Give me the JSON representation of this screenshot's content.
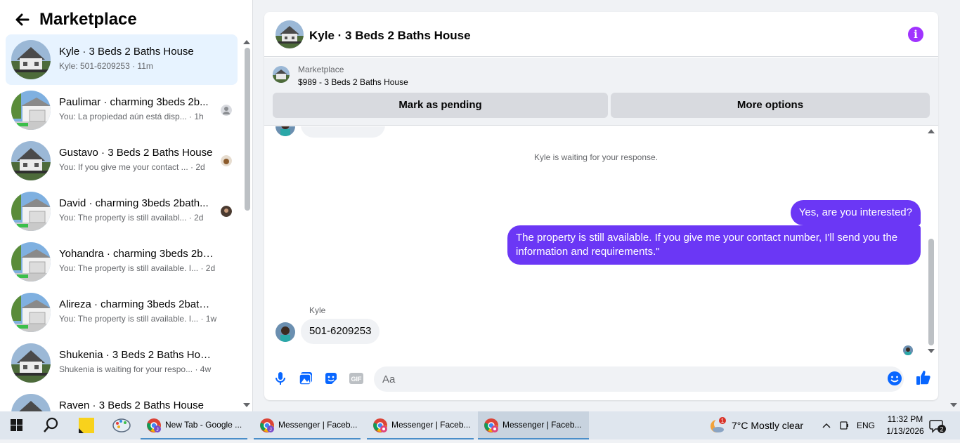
{
  "sidebar": {
    "title": "Marketplace",
    "conversations": [
      {
        "name": "Kyle · 3 Beds 2 Baths House",
        "preview": "Kyle: 501-6209253",
        "time": "11m",
        "avatar": "house"
      },
      {
        "name": "Paulimar · charming 3beds 2b...",
        "preview": "You: La propiedad aún está disp...",
        "time": "1h",
        "avatar": "garage"
      },
      {
        "name": "Gustavo · 3 Beds 2 Baths House",
        "preview": "You: If you give me your contact ...",
        "time": "2d",
        "avatar": "house"
      },
      {
        "name": "David · charming 3beds 2bath...",
        "preview": "You: The property is still availabl...",
        "time": "2d",
        "avatar": "garage"
      },
      {
        "name": "Yohandra · charming 3beds 2bat...",
        "preview": "You: The property is still available. I...",
        "time": "2d",
        "avatar": "garage"
      },
      {
        "name": "Alireza · charming 3beds 2bathr...",
        "preview": "You: The property is still available. I...",
        "time": "1w",
        "avatar": "garage"
      },
      {
        "name": "Shukenia · 3 Beds 2 Baths House",
        "preview": "Shukenia is waiting for your respo...",
        "time": "4w",
        "avatar": "house"
      },
      {
        "name": "Raven · 3 Beds 2 Baths House",
        "preview": "",
        "time": "",
        "avatar": "house"
      }
    ]
  },
  "chat": {
    "title": "Kyle · 3 Beds 2 Baths House",
    "marketplace_label": "Marketplace",
    "listing": "$989 - 3 Beds 2 Baths House",
    "mark_pending": "Mark as pending",
    "more_options": "More options",
    "waiting_notice": "Kyle is waiting for your response.",
    "messages": {
      "out1": "Yes, are you interested?",
      "out2": "The property is still available. If you give me your contact number, I'll send you the information and requirements.\"",
      "sender": "Kyle",
      "in1": "501-6209253"
    },
    "composer_placeholder": "Aa",
    "accent_color": "#6b37f5"
  },
  "taskbar": {
    "apps": [
      {
        "label": "New Tab - Google ...",
        "badge": "J"
      },
      {
        "label": "Messenger | Faceb...",
        "badge": "J"
      },
      {
        "label": "Messenger | Faceb...",
        "badge": ""
      },
      {
        "label": "Messenger | Faceb...",
        "badge": ""
      }
    ],
    "weather": "7°C  Mostly clear",
    "weather_badge": "1",
    "language": "ENG",
    "time": "11:32 PM",
    "date": "1/13/2026",
    "notifications": "2"
  }
}
